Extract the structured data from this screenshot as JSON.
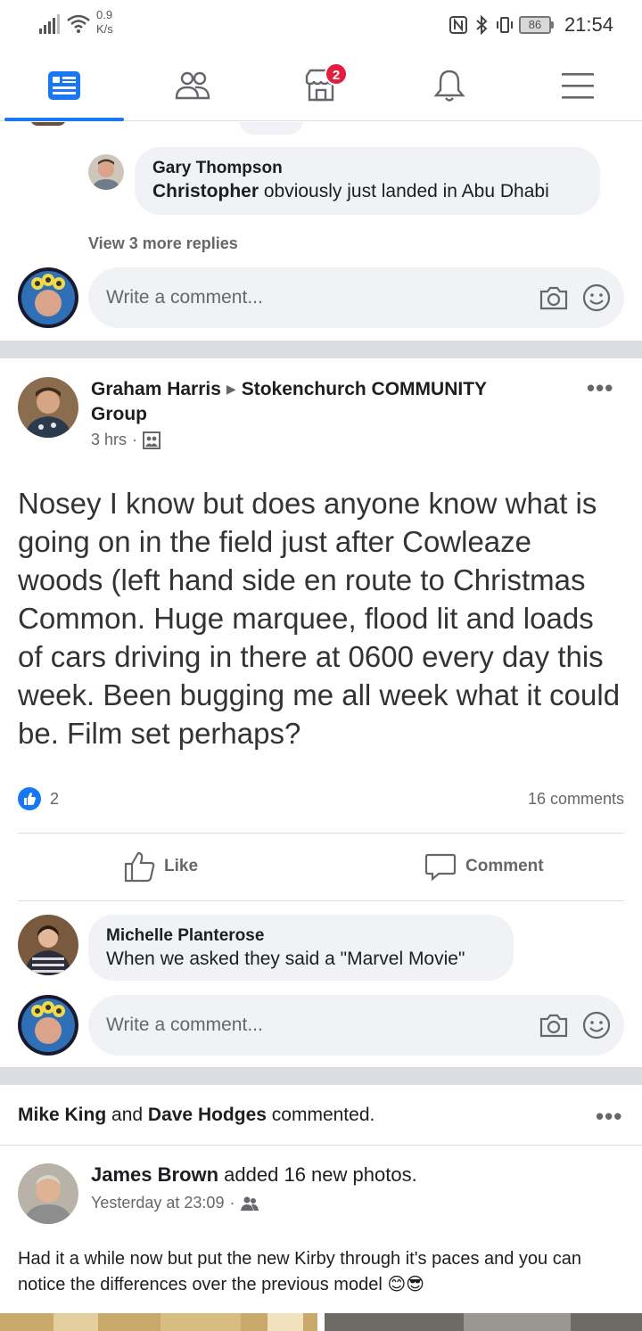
{
  "status_bar": {
    "net_speed_value": "0.9",
    "net_speed_unit": "K/s",
    "battery": "86",
    "time": "21:54"
  },
  "nav": {
    "tabs": [
      {
        "name": "news-feed",
        "icon": "news-feed-icon",
        "active": true
      },
      {
        "name": "friends",
        "icon": "friends-icon",
        "active": false
      },
      {
        "name": "marketplace",
        "icon": "marketplace-icon",
        "active": false,
        "badge": "2"
      },
      {
        "name": "notifications",
        "icon": "bell-icon",
        "active": false
      },
      {
        "name": "menu",
        "icon": "hamburger-menu-icon",
        "active": false
      }
    ],
    "accent_color": "#1877f2",
    "badge_color": "#e41e3f"
  },
  "post1": {
    "reply": {
      "author": "Gary Thompson",
      "mention": "Christopher",
      "text": " obviously just landed in Abu Dhabi"
    },
    "view_more_replies": "View 3 more replies",
    "comment_placeholder": "Write a comment..."
  },
  "post2": {
    "author": "Graham Harris",
    "group_line1": "Stokenchurch COMMUNITY",
    "group_line2": "Group",
    "time": "3 hrs",
    "privacy_icon": "group-icon",
    "body": "Nosey I know but does anyone know what is going on in the field just after Cowleaze woods (left hand side en route to Christmas Common. Huge marquee, flood lit and loads of cars driving in there at 0600 every day this week. Been bugging me all week what it could be. Film set perhaps?",
    "like_count": "2",
    "comments_count": "16 comments",
    "like_label": "Like",
    "comment_label": "Comment",
    "top_comment": {
      "author": "Michelle Planterose",
      "text": "When we asked they said a \"Marvel Movie\""
    },
    "comment_placeholder": "Write a comment..."
  },
  "post3": {
    "activity_user1": "Mike King",
    "activity_and": " and ",
    "activity_user2": "Dave Hodges",
    "activity_suffix": " commented.",
    "author": "James Brown",
    "action": " added 16 new photos.",
    "time": "Yesterday at 23:09",
    "body": "Had it a while now but put the new Kirby through it's paces and you can notice the differences over the previous model",
    "emojis": "😊😎"
  }
}
